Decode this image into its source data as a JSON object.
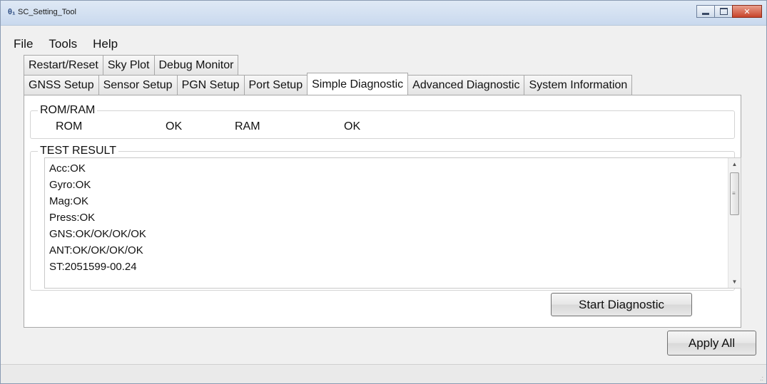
{
  "window": {
    "title": "SC_Setting_Tool",
    "app_icon": "θ₁"
  },
  "menu": [
    "File",
    "Tools",
    "Help"
  ],
  "tabs_upper": [
    "Restart/Reset",
    "Sky Plot",
    "Debug Monitor"
  ],
  "tabs_lower": [
    "GNSS Setup",
    "Sensor Setup",
    "PGN Setup",
    "Port Setup",
    "Simple Diagnostic",
    "Advanced Diagnostic",
    "System Information"
  ],
  "active_tab": "Simple Diagnostic",
  "rom_ram": {
    "title": "ROM/RAM",
    "rom_label": "ROM",
    "rom_status": "OK",
    "ram_label": "RAM",
    "ram_status": "OK"
  },
  "test_result": {
    "title": "TEST RESULT",
    "lines": [
      "Acc:OK",
      "Gyro:OK",
      "Mag:OK",
      "Press:OK",
      "GNS:OK/OK/OK/OK",
      "ANT:OK/OK/OK/OK",
      "ST:2051599-00.24"
    ]
  },
  "buttons": {
    "start_diagnostic": "Start Diagnostic",
    "apply_all": "Apply All"
  }
}
